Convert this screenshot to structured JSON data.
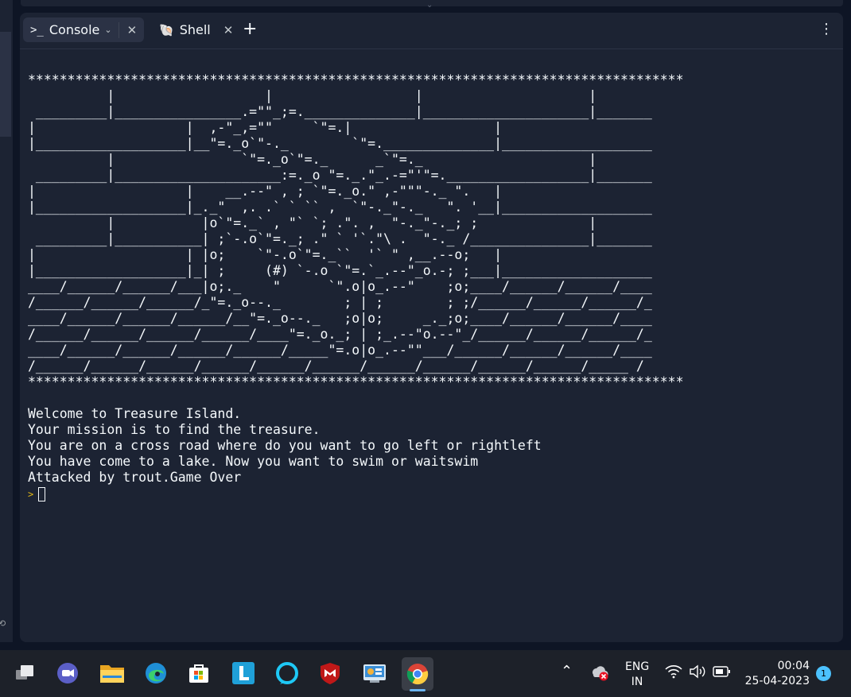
{
  "tabs": [
    {
      "label": "Console",
      "icon": "terminal-prompt-icon",
      "active": true
    },
    {
      "label": "Shell",
      "icon": "shell-icon",
      "active": false
    }
  ],
  "console": {
    "output": "***********************************************************************************\n          |                   |                  |                     |\n _________|________________.=\"\"_;=.______________|_____________________|_______\n|                   |  ,-\"_,=\"\"     `\"=.|                  |\n|___________________|__\"=._o`\"-._        `\"=.______________|___________________\n          |                `\"=._o`\"=._      _`\"=._                     |\n _________|_____________________:=._o \"=._.\"_.-=\"'\"=.__________________|_______\n|                   |    __.--\" , ; `\"=._o.\" ,-\"\"\"-._ \".   |\n|___________________|_._\"  ,. .` ` `` ,  `\"-._\"-._   \". '__|___________________\n          |           |o`\"=._` , \"` `; .\". ,  \"-._\"-._; ;              |\n _________|___________| ;`-.o`\"=._; .\" ` '`.\"\\ .  \"-._ /_______________|_______\n|                   | |o;    `\"-.o`\"=._``  '` \" ,__.--o;   |\n|___________________|_| ;     (#) `-.o `\"=.`_.--\"_o.-; ;___|___________________\n____/______/______/___|o;._    \"      `\".o|o_.--\"    ;o;____/______/______/____\n/______/______/______/_\"=._o--._        ; | ;        ; ;/______/______/______/_\n____/______/______/______/__\"=._o--._   ;o|o;     _._;o;____/______/______/____\n/______/______/______/______/____\"=._o._; | ;_.--\"o.--\"_/______/______/______/_\n____/______/______/______/______/_____\"=.o|o_.--\"\"___/______/______/______/____\n/______/______/______/______/______/______/______/______/______/______/_____ /\n***********************************************************************************\n\nWelcome to Treasure Island.\nYour mission is to find the treasure.\nYou are on a cross road where do you want to go left or rightleft\nYou have come to a lake. Now you want to swim or waitswim\nAttacked by trout.Game Over",
    "prompt": ">"
  },
  "taskbar": {
    "apps": [
      "task-view-icon",
      "zoom-icon",
      "file-explorer-icon",
      "edge-icon",
      "microsoft-store-icon",
      "l-app-icon",
      "alexa-icon",
      "mcafee-icon",
      "control-panel-icon",
      "chrome-icon"
    ],
    "language": "ENG",
    "region": "IN",
    "time": "00:04",
    "date": "25-04-2023",
    "notifications": "1"
  },
  "colors": {
    "panel": "#1c2333",
    "background": "#0e1525",
    "prompt": "#e2b714",
    "taskbar": "#1d2129"
  }
}
